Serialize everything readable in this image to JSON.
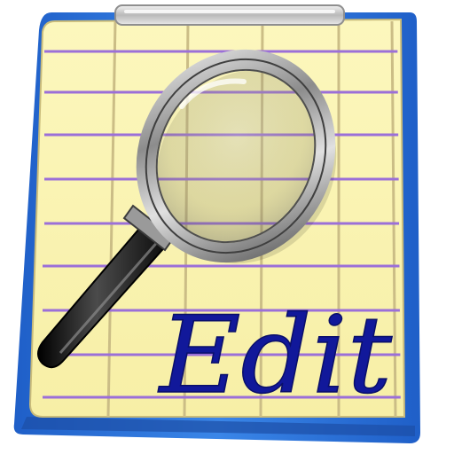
{
  "icon": {
    "name": "edit-spreadsheet-app-icon",
    "label": "Edit",
    "symbols": [
      "clipboard-icon",
      "ledger-sheet-icon",
      "magnifying-glass-icon"
    ]
  },
  "colors": {
    "clipboard": "#2e6fd6",
    "paper": "#fbf5b4",
    "ruled_lines": "#9b6fd8",
    "grid_lines": "#cbbd86",
    "label": "#11189a",
    "magnifier_frame": "#7d7d7d",
    "magnifier_handle": "#1a1a1a"
  },
  "sheet": {
    "ruled_line_count": 9,
    "column_divider_count": 5
  }
}
